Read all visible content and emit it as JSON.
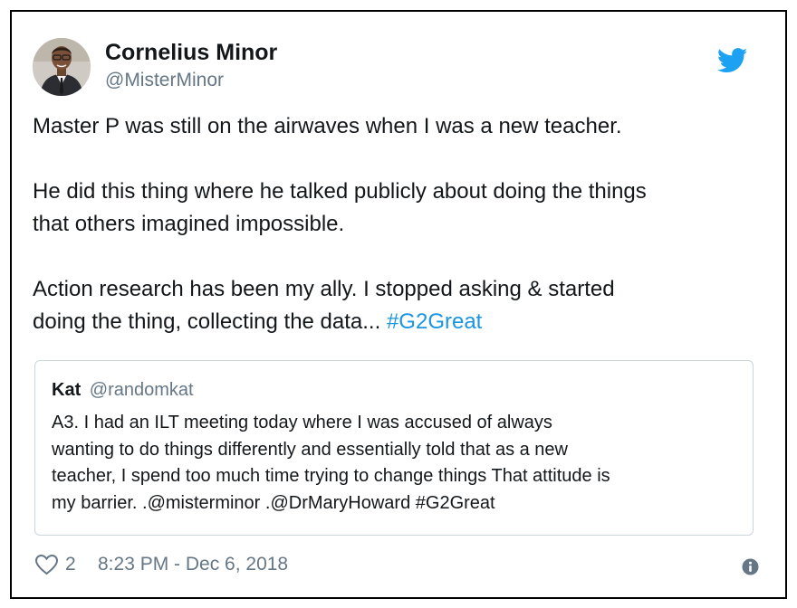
{
  "author": {
    "name": "Cornelius Minor",
    "handle": "@MisterMinor"
  },
  "tweet": {
    "paragraph_1": "Master P was still on the airwaves when I was a new teacher.",
    "paragraph_2_line_1": "He did this thing where he talked publicly about doing the things",
    "paragraph_2_line_2": "that others imagined impossible.",
    "paragraph_3_line_1": "Action research has been my ally. I stopped asking & started",
    "paragraph_3_line_2": "doing the thing, collecting the data...",
    "hashtag": "#G2Great"
  },
  "quoted_tweet": {
    "name": "Kat",
    "handle": "@randomkat",
    "lines": [
      "A3. I had an ILT meeting today where I was accused of always",
      "wanting to do things differently and essentially told that as a new",
      "teacher, I spend too much time trying to change things  That attitude is",
      "my barrier. .@misterminor .@DrMaryHoward #G2Great"
    ]
  },
  "footer": {
    "like_count": "2",
    "timestamp": "8:23 PM - Dec 6, 2018"
  },
  "colors": {
    "text": "#14171a",
    "secondary": "#657786",
    "link": "#1b95e0",
    "twitter_blue": "#1da1f2",
    "quote_border": "#ccd6dd"
  },
  "icons": {
    "brand": "twitter-bird-icon",
    "like": "heart-icon",
    "info": "info-icon"
  }
}
